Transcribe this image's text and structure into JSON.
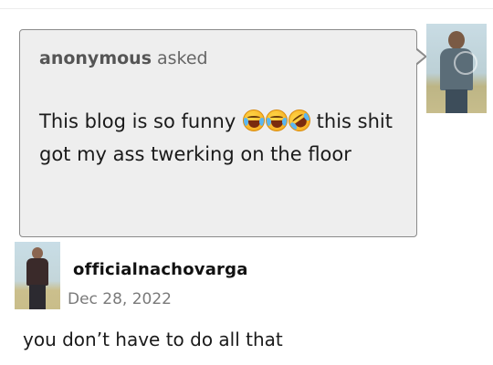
{
  "ask": {
    "asker_name": "anonymous",
    "asker_verb": "asked",
    "question_part1": "This blog is so funny",
    "emojis": [
      "face-with-tears-of-joy",
      "face-with-tears-of-joy",
      "rolling-on-the-floor-laughing"
    ],
    "question_part2": "this shit got my ass twerking on the floor"
  },
  "answer": {
    "username": "officialnachovarga",
    "date": "Dec 28, 2022",
    "text": "you don’t have to do all that"
  },
  "colors": {
    "bubble_bg": "#eeeeee",
    "bubble_border": "#8a8a8a",
    "date_text": "#7a7a7a"
  }
}
